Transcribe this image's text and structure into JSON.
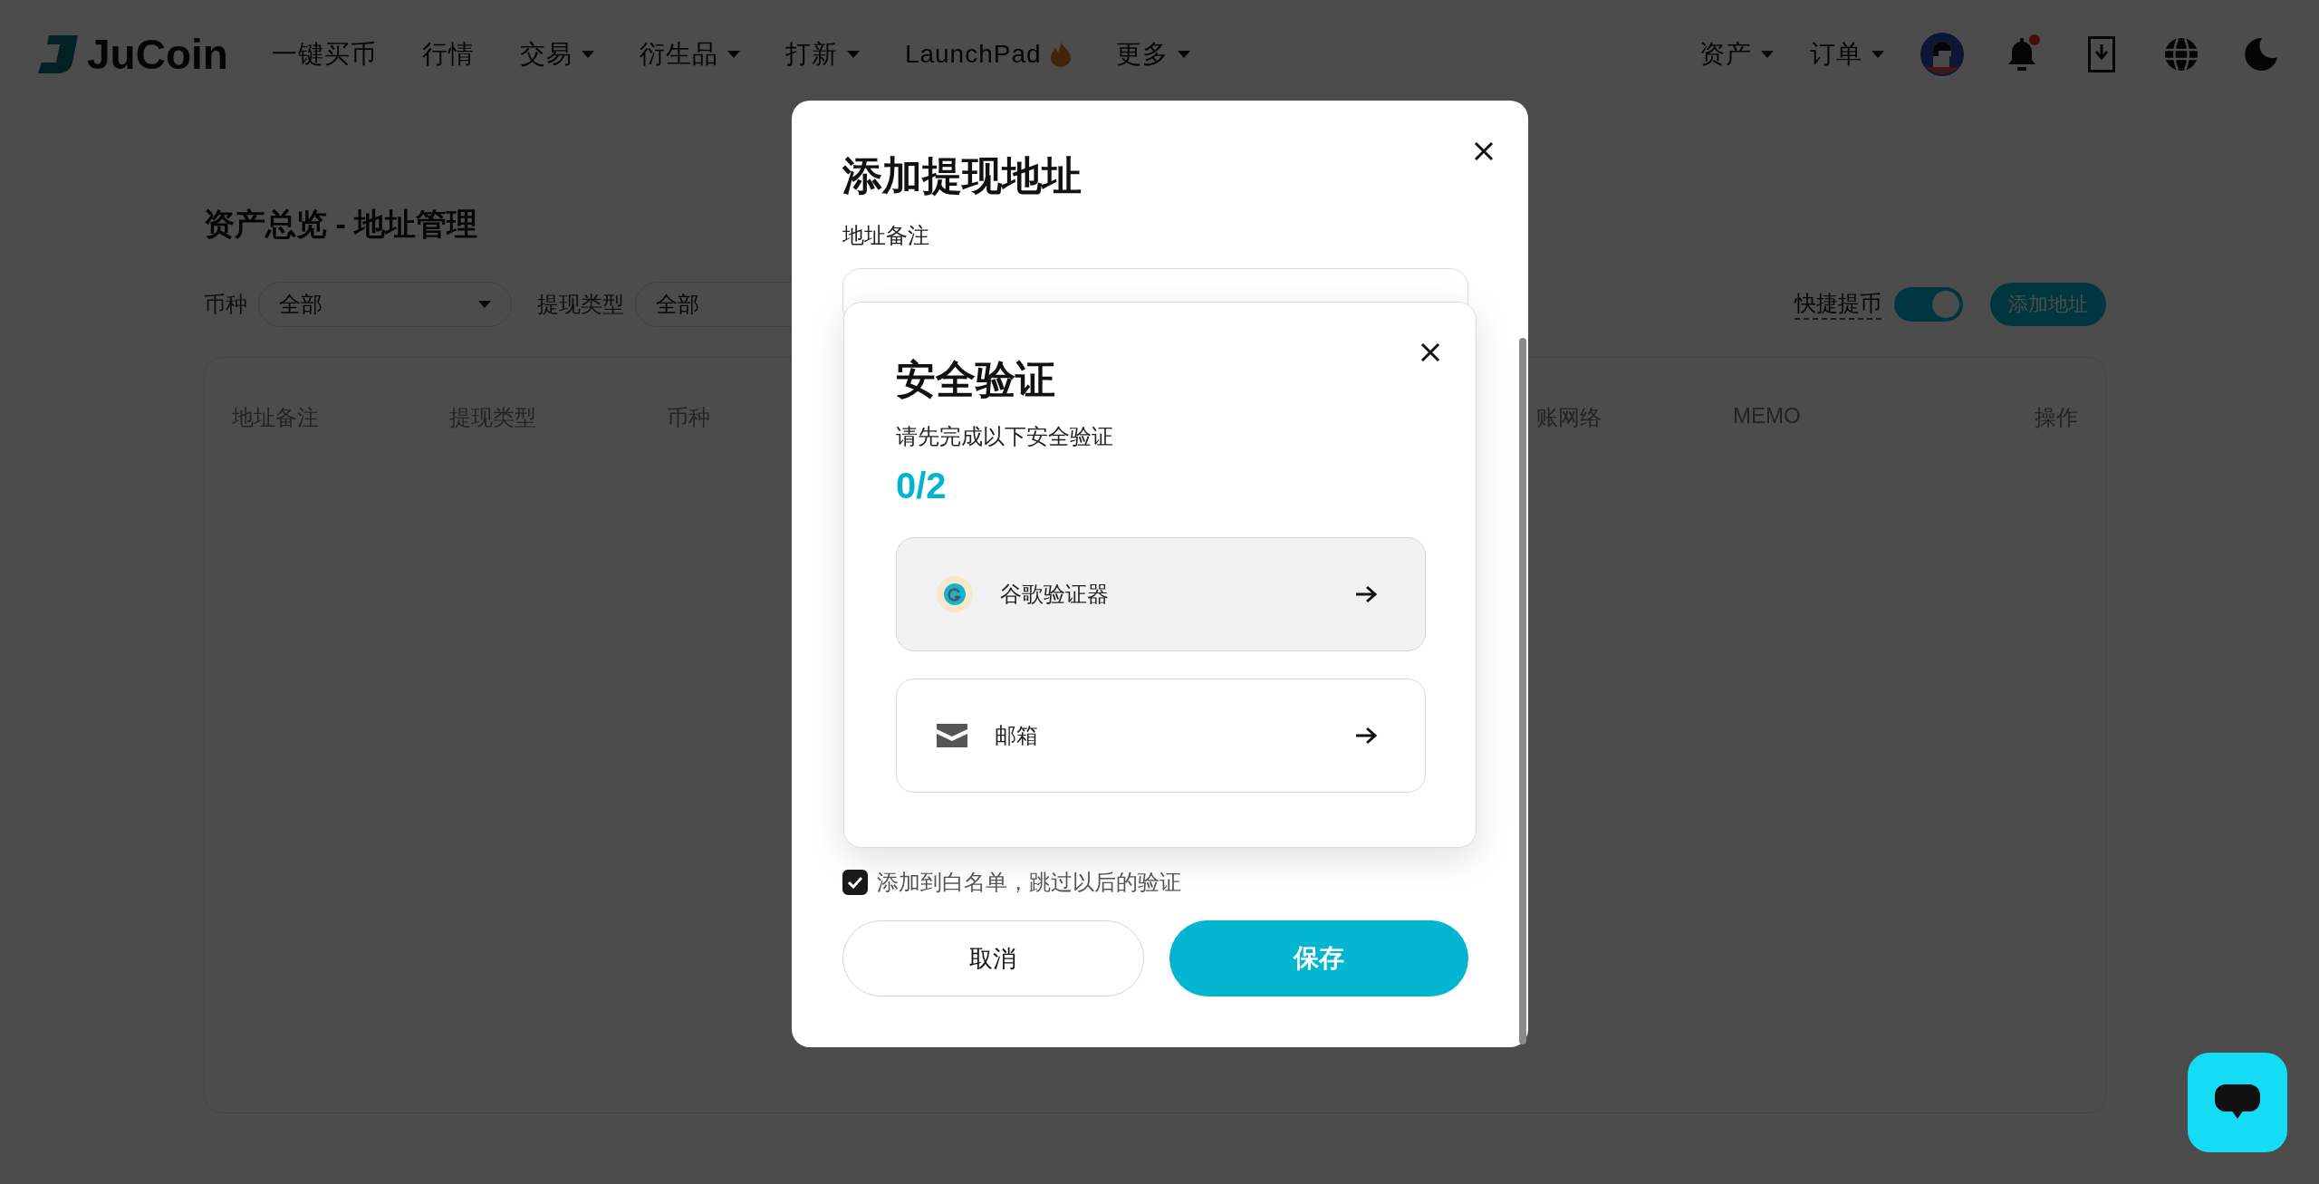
{
  "header": {
    "logo": "JuCoin",
    "nav": [
      {
        "label": "一键买币",
        "dropdown": false,
        "hot": false
      },
      {
        "label": "行情",
        "dropdown": false,
        "hot": false
      },
      {
        "label": "交易",
        "dropdown": true,
        "hot": false
      },
      {
        "label": "衍生品",
        "dropdown": true,
        "hot": false
      },
      {
        "label": "打新",
        "dropdown": true,
        "hot": false
      },
      {
        "label": "LaunchPad",
        "dropdown": false,
        "hot": true
      },
      {
        "label": "更多",
        "dropdown": true,
        "hot": false
      }
    ],
    "right_menu": [
      {
        "label": "资产",
        "dropdown": true
      },
      {
        "label": "订单",
        "dropdown": true
      }
    ],
    "notification_unread": true
  },
  "page": {
    "title": "资产总览 - 地址管理",
    "filters": [
      {
        "label": "币种",
        "value": "全部",
        "dropdown": true
      },
      {
        "label": "提现类型",
        "value": "全部"
      }
    ],
    "quick_withdraw": {
      "label": "快捷提币",
      "on": true
    },
    "add_button": "添加地址",
    "table": {
      "columns": [
        {
          "label": "地址备注"
        },
        {
          "label": "提现类型"
        },
        {
          "label": "币种"
        },
        {
          "label": "账网络"
        },
        {
          "label": "MEMO"
        },
        {
          "label": "操作"
        }
      ]
    }
  },
  "modal": {
    "title": "添加提现地址",
    "field_label": "地址备注",
    "whitelist": {
      "label": "添加到白名单，跳过以后的验证",
      "checked": true
    },
    "cancel": "取消",
    "save": "保存"
  },
  "verification": {
    "title": "安全验证",
    "subtitle": "请先完成以下安全验证",
    "progress": "0/2",
    "methods": [
      {
        "kind": "google",
        "label": "谷歌验证器",
        "selected": true
      },
      {
        "kind": "email",
        "label": "邮箱",
        "selected": false
      }
    ]
  }
}
